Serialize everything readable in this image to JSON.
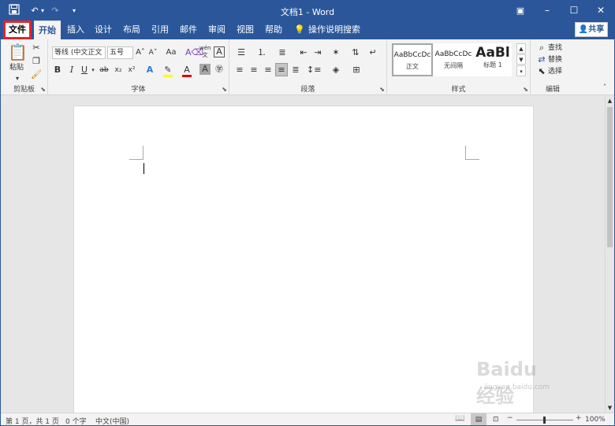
{
  "window": {
    "title": "文档1 - Word"
  },
  "qat": {
    "save_icon": "save-icon",
    "undo_icon": "undo-icon",
    "redo_icon": "redo-icon",
    "customize_icon": "customize-qat-icon"
  },
  "tabs": [
    {
      "label": "文件"
    },
    {
      "label": "开始"
    },
    {
      "label": "插入"
    },
    {
      "label": "设计"
    },
    {
      "label": "布局"
    },
    {
      "label": "引用"
    },
    {
      "label": "邮件"
    },
    {
      "label": "审阅"
    },
    {
      "label": "视图"
    },
    {
      "label": "帮助"
    }
  ],
  "tell_me": "操作说明搜索",
  "share_label": "共享",
  "ribbon": {
    "clipboard": {
      "paste": "粘贴",
      "label": "剪贴板"
    },
    "font": {
      "font_name": "等线 (中文正文",
      "font_size": "五号",
      "label": "字体",
      "change_case": "Aa"
    },
    "paragraph": {
      "label": "段落"
    },
    "styles": {
      "label": "样式",
      "items": [
        {
          "preview": "AaBbCcDc",
          "name": "正文"
        },
        {
          "preview": "AaBbCcDc",
          "name": "无间隔"
        },
        {
          "preview": "AaBl",
          "name": "标题 1"
        }
      ]
    },
    "editing": {
      "find": "查找",
      "replace": "替换",
      "select": "选择",
      "label": "编辑"
    }
  },
  "status": {
    "page": "第 1 页，共 1 页",
    "words": "0 个字",
    "language": "中文(中国)",
    "zoom": "100%"
  },
  "watermark": "Baidu经验",
  "watermark_url": "jingyan.baidu.com"
}
